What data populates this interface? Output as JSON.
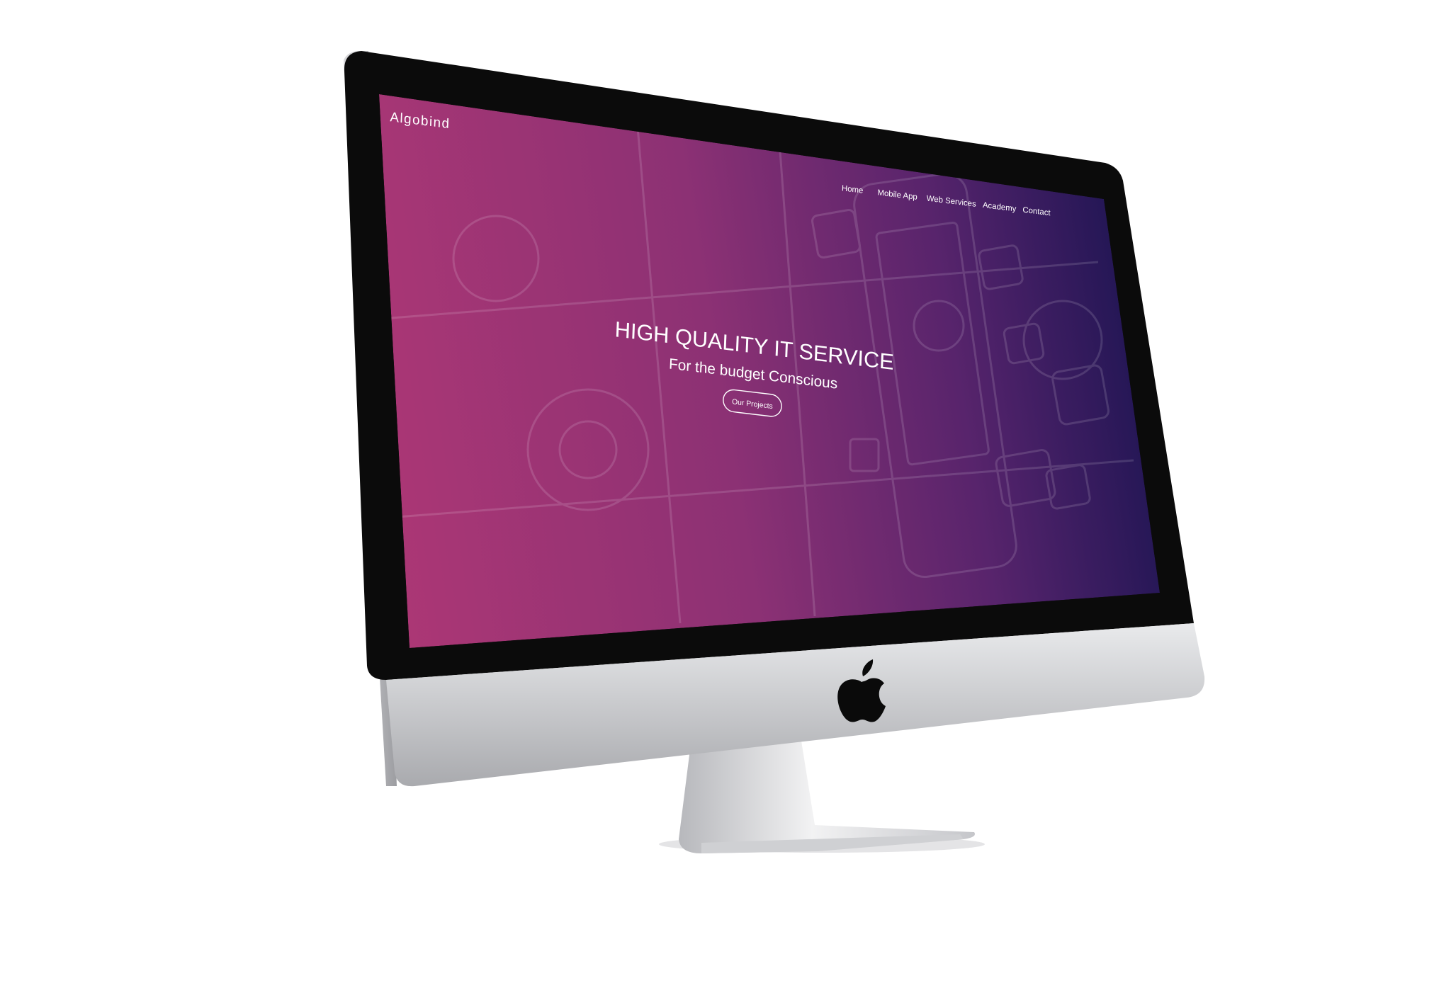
{
  "site": {
    "brand": "Algobind",
    "nav": [
      {
        "label": "Home"
      },
      {
        "label": "Mobile App"
      },
      {
        "label": "Web Services"
      },
      {
        "label": "Academy"
      },
      {
        "label": "Contact"
      }
    ],
    "hero": {
      "title": "HIGH QUALITY IT SERVICE",
      "subtitle": "For the budget Conscious",
      "cta_label": "Our Projects",
      "background_icons": [
        "gear-icon",
        "phone-illustration",
        "lock-icon",
        "chart-icon",
        "saas-badge",
        "cloud-icon",
        "user-icon",
        "tiles-icon"
      ]
    }
  },
  "device": {
    "logo_icon": "apple-logo-icon"
  },
  "colors": {
    "gradient_left": "#a83372",
    "gradient_mid": "#7e2a70",
    "gradient_right": "#1c1250",
    "text": "#ffffff",
    "bezel": "#0b0b0b",
    "chin": "#dedfe3"
  }
}
